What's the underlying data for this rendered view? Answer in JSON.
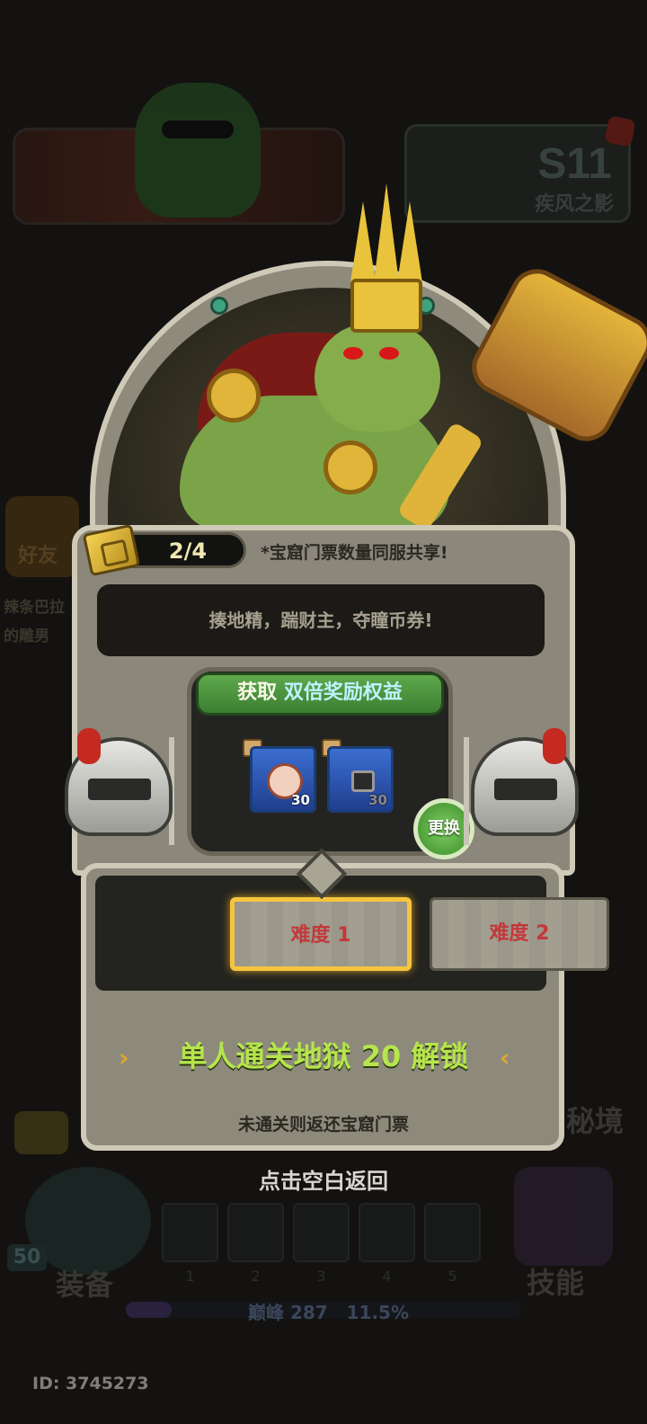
{
  "background": {
    "season_badge": "S11",
    "season_name": "疾风之影",
    "friends_label": "好友",
    "side_text_1": "辣条巴拉",
    "side_text_2": "的雕男",
    "player_level": "50",
    "equip_label": "装备",
    "skill_label": "技能",
    "realm_label": "秘境",
    "slot_numbers": [
      "1",
      "2",
      "3",
      "4",
      "5"
    ],
    "peak_label": "巅峰 287",
    "peak_percent": "11.5%",
    "peak_progress": 0.115,
    "player_id": "ID: 3745273"
  },
  "modal": {
    "ticket_count": "2/4",
    "ticket_note": "*宝窟门票数量同服共享!",
    "description": "揍地精，踹财主，夺瞳币券!",
    "reward_header_prefix": "获取",
    "reward_header_highlight": "双倍奖励权益",
    "reward_items": [
      {
        "icon": "ticket-icon",
        "count": "30",
        "locked": false
      },
      {
        "icon": "lock-icon",
        "count": "30",
        "locked": true
      }
    ],
    "swap_button": "更换",
    "difficulties": [
      "难度 1",
      "难度 2"
    ],
    "selected_difficulty": "难度 1",
    "unlock_condition": "单人通关地狱 20 解锁",
    "refund_note": "未通关则返还宝窟门票",
    "close_hint": "点击空白返回"
  },
  "colors": {
    "accent_green": "#b6e54c",
    "difficulty_text": "#c3383a",
    "selected_border": "#f6c53d"
  }
}
